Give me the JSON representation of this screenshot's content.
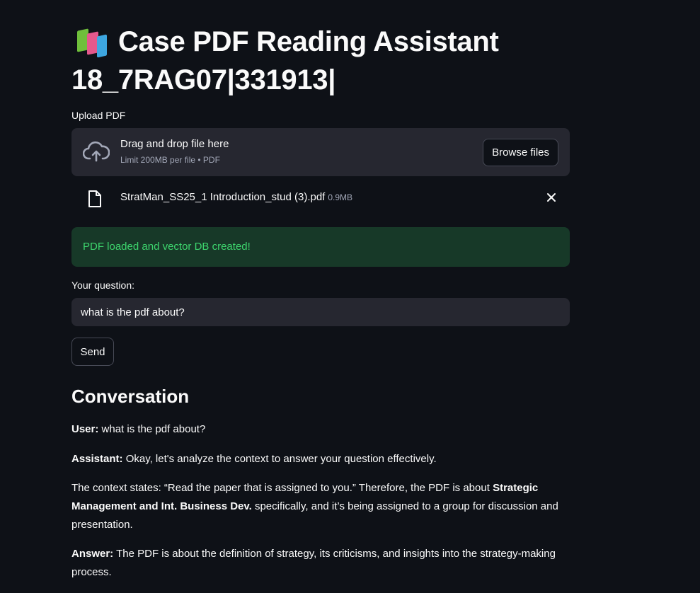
{
  "header": {
    "icon": "books-emoji",
    "title_line1": "Case PDF Reading Assistant",
    "title_line2": "18_7RAG07|331913|"
  },
  "uploader": {
    "label": "Upload PDF",
    "drop_title": "Drag and drop file here",
    "drop_subtitle": "Limit 200MB per file • PDF",
    "browse_label": "Browse files",
    "file": {
      "name": "StratMan_SS25_1 Introduction_stud (3).pdf",
      "size": "0.9MB"
    }
  },
  "status": {
    "message": "PDF loaded and vector DB created!",
    "color": "#3dd56d"
  },
  "question": {
    "label": "Your question:",
    "value": "what is the pdf about?"
  },
  "send_label": "Send",
  "conversation": {
    "heading": "Conversation",
    "user_label": "User:",
    "user_text": "what is the pdf about?",
    "assistant_label": "Assistant:",
    "assistant_text": "Okay, let's analyze the context to answer your question effectively.",
    "context_pre": "The context states: “Read the paper that is assigned to you.” Therefore, the PDF is about ",
    "context_bold": "Strategic Management and Int. Business Dev.",
    "context_post": " specifically, and it’s being assigned to a group for discussion and presentation.",
    "answer_label": "Answer:",
    "answer_text": "The PDF is about the definition of strategy, its criticisms, and insights into the strategy-making process."
  }
}
